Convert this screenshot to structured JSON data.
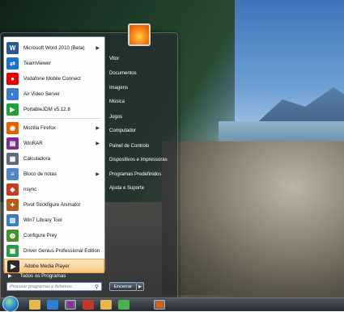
{
  "start_menu": {
    "programs": [
      {
        "label": "Microsoft Word 2010 (Beta)",
        "icon": "word-icon",
        "color": "#2b5797",
        "glyph": "W",
        "has_arrow": true
      },
      {
        "label": "TeamViewer",
        "icon": "teamviewer-icon",
        "color": "#1b6fd1",
        "glyph": "⇄",
        "has_arrow": false
      },
      {
        "label": "Vodafone Mobile Connect",
        "icon": "vodafone-icon",
        "color": "#e60000",
        "glyph": "●",
        "has_arrow": false
      },
      {
        "label": "Air Video Server",
        "icon": "airvideo-icon",
        "color": "#3a7bd5",
        "glyph": "◐",
        "has_arrow": false
      },
      {
        "label": "PortableJDM v5.12.8",
        "icon": "jdm-icon",
        "color": "#1e9e3a",
        "glyph": "▶",
        "has_arrow": false
      },
      {
        "label": "Mozilla Firefox",
        "icon": "firefox-icon",
        "color": "#e66000",
        "glyph": "◉",
        "has_arrow": true
      },
      {
        "label": "WinRAR",
        "icon": "winrar-icon",
        "color": "#7a2f8f",
        "glyph": "▤",
        "has_arrow": true
      },
      {
        "label": "Calculadora",
        "icon": "calculator-icon",
        "color": "#5b6b7d",
        "glyph": "▦",
        "has_arrow": false
      },
      {
        "label": "Bloco de notas",
        "icon": "notepad-icon",
        "color": "#4f86c6",
        "glyph": "≡",
        "has_arrow": true
      },
      {
        "label": "nsync",
        "icon": "nsync-icon",
        "color": "#c23b22",
        "glyph": "◆",
        "has_arrow": false
      },
      {
        "label": "Pivot Stickfigure Animator",
        "icon": "pivot-icon",
        "color": "#b25b1a",
        "glyph": "✦",
        "has_arrow": false
      },
      {
        "label": "Win7 Library Tool",
        "icon": "library-icon",
        "color": "#3c78c3",
        "glyph": "▥",
        "has_arrow": false
      },
      {
        "label": "Configure Prey",
        "icon": "prey-icon",
        "color": "#4a8f2f",
        "glyph": "◍",
        "has_arrow": false
      },
      {
        "label": "Driver Genius Professional Edition",
        "icon": "driver-genius-icon",
        "color": "#2a9a46",
        "glyph": "▣",
        "has_arrow": false
      },
      {
        "label": "Adobe Media Player",
        "icon": "adobe-media-player-icon",
        "color": "#2a2a2a",
        "glyph": "▶",
        "has_arrow": false
      }
    ],
    "all_programs": "Todos os Programas",
    "search_placeholder": "Procurar programas e ficheiros",
    "right_items": [
      "Vitor",
      "Documentos",
      "Imagens",
      "Música",
      "Jogos",
      "Computador",
      "Painel de Controlo",
      "Dispositivos e Impressoras",
      "Programas Predefinidos",
      "Ajuda e Suporte"
    ],
    "shutdown_label": "Encerrar"
  },
  "taskbar": {
    "icons": [
      "explorer-icon",
      "media-player-icon",
      "winrar-taskbar-icon",
      "filezilla-icon",
      "folder-icon",
      "chrome-icon",
      "firefox-taskbar-icon"
    ]
  }
}
